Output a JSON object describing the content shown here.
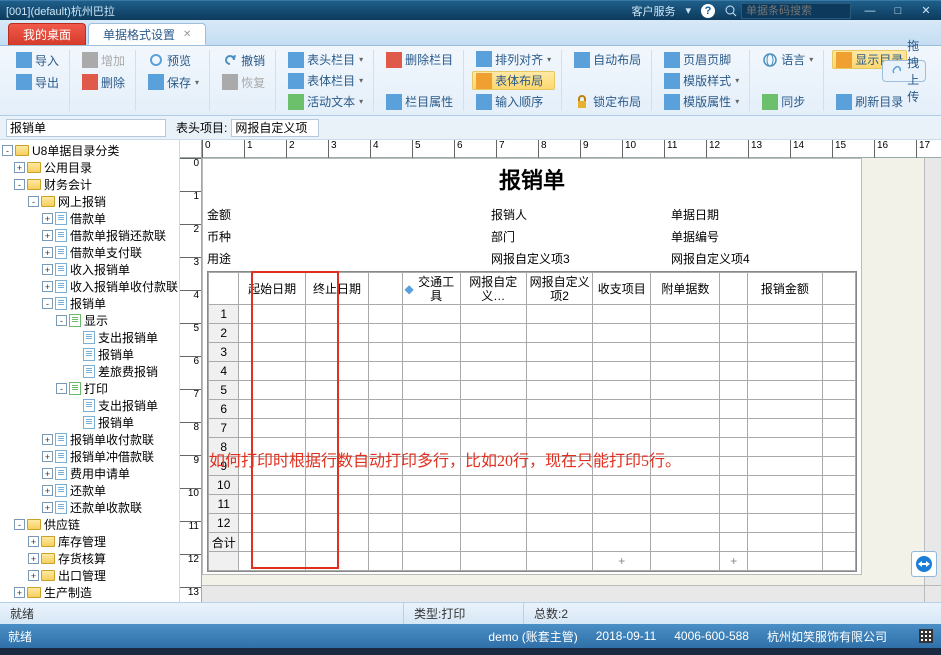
{
  "titlebar": {
    "left_text": "[001](default)杭州巴拉",
    "menu_label": "客户服务",
    "help_icon_name": "help-icon",
    "search_icon_name": "search-icon",
    "search_placeholder": "单据条码搜索"
  },
  "tabs": [
    {
      "label": "我的桌面",
      "kind": "red"
    },
    {
      "label": "单据格式设置",
      "kind": "active",
      "closable": true
    }
  ],
  "ribbon": {
    "g1": {
      "import": "导入",
      "export": "导出"
    },
    "g2": {
      "add": "增加",
      "delete": "删除"
    },
    "g3": {
      "preview": "预览",
      "save": "保存"
    },
    "g4": {
      "undo": "撤销",
      "redo": "恢复"
    },
    "g5": {
      "header_col": "表头栏目",
      "body_col": "表体栏目",
      "move_text": "活动文本",
      "remove_col": "删除栏目",
      "column_prop": "栏目属性"
    },
    "g6": {
      "align": "排列对齐",
      "layout": "表体布局",
      "tab_order": "输入顺序"
    },
    "g7": {
      "auto_layout": "自动布局",
      "lock_layout": "锁定布局"
    },
    "g8": {
      "header_footer": "页眉页脚",
      "tpl_style": "模版样式",
      "tpl_prop": "模版属性"
    },
    "g9": {
      "language": "语言",
      "sync": "同步"
    },
    "g10": {
      "show_toc": "显示目录",
      "refresh_toc": "刷新目录"
    },
    "callout": "拖拽上传"
  },
  "subbar": {
    "left_value": "报销单",
    "label": "表头项目:",
    "field_value": "网报自定义项"
  },
  "tree": [
    {
      "d": 0,
      "t": "-",
      "i": "f",
      "l": "U8单据目录分类"
    },
    {
      "d": 1,
      "t": "+",
      "i": "f",
      "l": "公用目录"
    },
    {
      "d": 1,
      "t": "-",
      "i": "f",
      "l": "财务会计"
    },
    {
      "d": 2,
      "t": "-",
      "i": "f",
      "l": "网上报销"
    },
    {
      "d": 3,
      "t": "+",
      "i": "d",
      "l": "借款单"
    },
    {
      "d": 3,
      "t": "+",
      "i": "d",
      "l": "借款单报销还款联"
    },
    {
      "d": 3,
      "t": "+",
      "i": "d",
      "l": "借款单支付联"
    },
    {
      "d": 3,
      "t": "+",
      "i": "d",
      "l": "收入报销单"
    },
    {
      "d": 3,
      "t": "+",
      "i": "d",
      "l": "收入报销单收付款联"
    },
    {
      "d": 3,
      "t": "-",
      "i": "d",
      "l": "报销单"
    },
    {
      "d": 4,
      "t": "-",
      "i": "g",
      "l": "显示"
    },
    {
      "d": 5,
      "t": " ",
      "i": "p",
      "l": "支出报销单"
    },
    {
      "d": 5,
      "t": " ",
      "i": "p",
      "l": "报销单"
    },
    {
      "d": 5,
      "t": " ",
      "i": "p",
      "l": "差旅费报销"
    },
    {
      "d": 4,
      "t": "-",
      "i": "g",
      "l": "打印"
    },
    {
      "d": 5,
      "t": " ",
      "i": "p",
      "l": "支出报销单"
    },
    {
      "d": 5,
      "t": " ",
      "i": "p",
      "l": "报销单"
    },
    {
      "d": 3,
      "t": "+",
      "i": "d",
      "l": "报销单收付款联"
    },
    {
      "d": 3,
      "t": "+",
      "i": "d",
      "l": "报销单冲借款联"
    },
    {
      "d": 3,
      "t": "+",
      "i": "d",
      "l": "费用申请单"
    },
    {
      "d": 3,
      "t": "+",
      "i": "d",
      "l": "还款单"
    },
    {
      "d": 3,
      "t": "+",
      "i": "d",
      "l": "还款单收款联"
    },
    {
      "d": 1,
      "t": "-",
      "i": "f",
      "l": "供应链"
    },
    {
      "d": 2,
      "t": "+",
      "i": "f",
      "l": "库存管理"
    },
    {
      "d": 2,
      "t": "+",
      "i": "f",
      "l": "存货核算"
    },
    {
      "d": 2,
      "t": "+",
      "i": "f",
      "l": "出口管理"
    },
    {
      "d": 1,
      "t": "+",
      "i": "f",
      "l": "生产制造"
    }
  ],
  "report": {
    "title": "报销单",
    "rows": [
      {
        "a": "金额",
        "b": "报销人",
        "c": "单据日期"
      },
      {
        "a": "币种",
        "b": "部门",
        "c": "单据编号"
      },
      {
        "a": "用途",
        "b": "网报自定义项3",
        "c": "网报自定义项4"
      }
    ],
    "cols": [
      "起始日期",
      "终止日期",
      "",
      "交通工具",
      "网报自定义…",
      "网报自定义项2",
      "收支项目",
      "附单据数",
      "",
      "报销金额",
      ""
    ],
    "row_numbers": [
      "1",
      "2",
      "3",
      "4",
      "5",
      "6",
      "7",
      "8",
      "9",
      "10",
      "11",
      "12"
    ],
    "sum_label": "合计"
  },
  "overlay_text": "如何打印时根据行数自动打印多行，比如20行，现在只能打印5行。",
  "status1": {
    "ready": "就绪",
    "type_label": "类型:",
    "type_value": "打印",
    "total_label": "总数:",
    "total_value": "2"
  },
  "status2": {
    "ready": "就绪",
    "user": "demo (账套主管)",
    "date": "2018-09-11",
    "phone": "4006-600-588",
    "company": "杭州如笑服饰有限公司"
  }
}
